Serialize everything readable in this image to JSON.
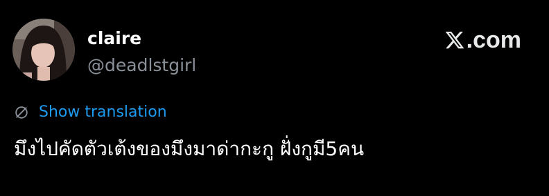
{
  "author": {
    "display_name": "claire",
    "handle": "@deadlstgirl"
  },
  "brand": {
    "icon": "x-logo-icon",
    "text": ".com"
  },
  "translation": {
    "icon": "globe-slash-icon",
    "label": "Show translation"
  },
  "tweet": {
    "text": "มึงไปคัดตัวเต้งของมึงมาด่ากะกู ฝั่งกูมี5คน"
  },
  "colors": {
    "background": "#000000",
    "link": "#1d9bf0",
    "secondary_text": "#8b9199"
  }
}
